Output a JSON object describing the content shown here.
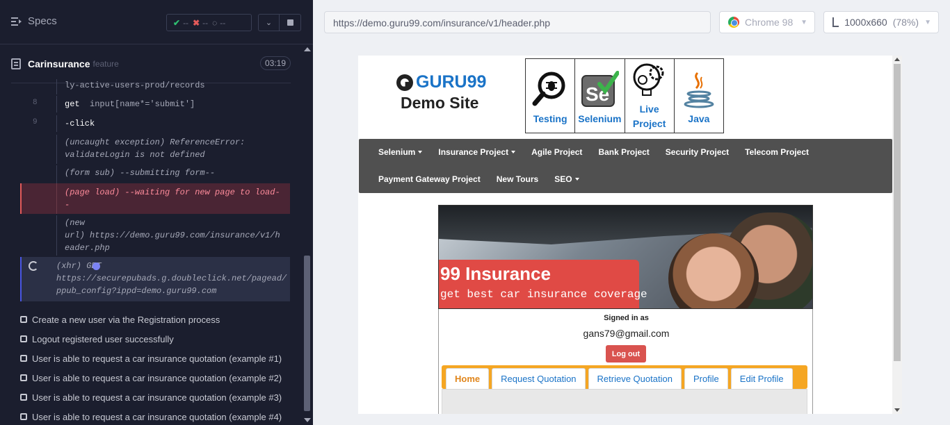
{
  "reporter": {
    "specs_label": "Specs",
    "stats": {
      "passed": "--",
      "failed": "--",
      "pending": "--"
    },
    "file": {
      "name": "Carinsurance",
      "type": "feature",
      "duration": "03:19"
    },
    "command_log": [
      {
        "num": "",
        "text": "ly-active-users-prod/records"
      },
      {
        "num": "8",
        "name": "get",
        "msg": "input[name*='submit']"
      },
      {
        "num": "9",
        "name": "-click",
        "msg": ""
      },
      {
        "num": "",
        "text_lines": [
          "(uncaught exception)  ReferenceError:",
          "validateLogin is not defined"
        ]
      },
      {
        "num": "",
        "text_lines": [
          "(form sub)  --submitting form--"
        ]
      },
      {
        "num": "",
        "text_lines": [
          "(page load)  --waiting for new page to load-",
          "-"
        ]
      },
      {
        "num": "",
        "text_lines": [
          "(new",
          "url)  https://demo.guru99.com/insurance/v1/h",
          "eader.php"
        ]
      },
      {
        "num": "",
        "text_lines": [
          "(xhr)  GET",
          "https://securepubads.g.doubleclick.net/pagead/",
          "ppub_config?ippd=demo.guru99.com"
        ]
      }
    ],
    "tests": [
      "Create a new user via the Registration process",
      "Logout registered user successfully",
      "User is able to request a car insurance quotation (example #1)",
      "User is able to request a car insurance quotation (example #2)",
      "User is able to request a car insurance quotation (example #3)",
      "User is able to request a car insurance quotation (example #4)"
    ]
  },
  "aut": {
    "url": "https://demo.guru99.com/insurance/v1/header.php",
    "browser": "Chrome 98",
    "viewport": "1000x660",
    "zoom": "(78%)"
  },
  "site": {
    "logo_brand": "GURU99",
    "logo_sub": "Demo Site",
    "tiles": [
      "Testing",
      "Selenium",
      "Live Project",
      "Java"
    ],
    "tile_icons": [
      "magnifier-bug-icon",
      "selenium-icon",
      "lightbulb-gear-icon",
      "java-icon"
    ],
    "nav_row1": [
      {
        "label": "Selenium",
        "dropdown": true
      },
      {
        "label": "Insurance Project",
        "dropdown": true
      },
      {
        "label": "Agile Project",
        "dropdown": false
      },
      {
        "label": "Bank Project",
        "dropdown": false
      },
      {
        "label": "Security Project",
        "dropdown": false
      },
      {
        "label": "Telecom Project",
        "dropdown": false
      }
    ],
    "nav_row2": [
      {
        "label": "Payment Gateway Project",
        "dropdown": false
      },
      {
        "label": "New Tours",
        "dropdown": false
      },
      {
        "label": "SEO",
        "dropdown": true
      }
    ],
    "banner_title": "99 Insurance",
    "banner_sub": "get best car insurance coverage",
    "signed_in_label": "Signed in as",
    "email": "gans79@gmail.com",
    "logout_label": "Log out",
    "tabs": [
      "Home",
      "Request Quotation",
      "Retrieve Quotation",
      "Profile",
      "Edit Profile"
    ],
    "active_tab": "Home"
  },
  "colors": {
    "reporter_bg": "#1b1e2e",
    "pass": "#2fbf71",
    "fail": "#e25a5a",
    "guru_blue": "#1a73c7",
    "nav_bg": "#505050",
    "banner_red": "#e04a45",
    "logout_red": "#d9534f",
    "tab_bar": "#f5a623"
  }
}
